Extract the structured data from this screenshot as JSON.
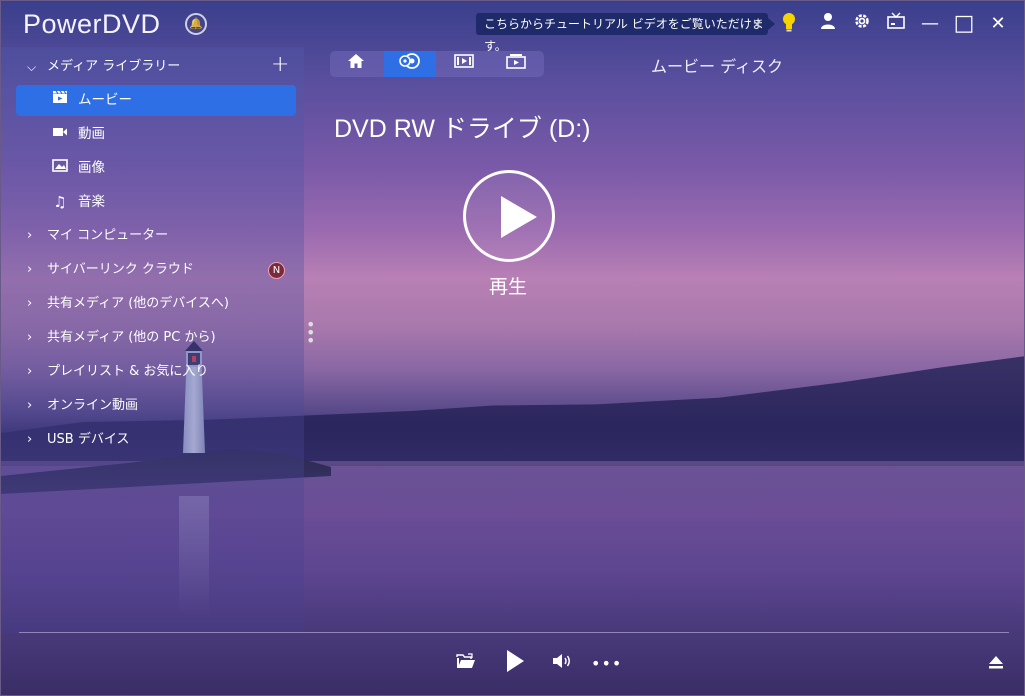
{
  "app": {
    "title": "PowerDVD"
  },
  "titlebar": {
    "tooltip": "こちらからチュートリアル ビデオをご覧いただけます。",
    "tooltip_close": "×",
    "icons": [
      "bell-icon",
      "lightbulb-icon",
      "user-icon",
      "gear-icon",
      "tv-mode-icon",
      "minimize-icon",
      "maximize-icon",
      "close-icon"
    ],
    "minimize": "—",
    "maximize": "□",
    "close": "✕"
  },
  "sidebar": {
    "library_label": "メディア ライブラリー",
    "library_items": [
      {
        "label": "ムービー",
        "icon": "movie-icon",
        "active": true
      },
      {
        "label": "動画",
        "icon": "video-icon",
        "active": false
      },
      {
        "label": "画像",
        "icon": "image-icon",
        "active": false
      },
      {
        "label": "音楽",
        "icon": "music-icon",
        "active": false
      }
    ],
    "nav_items": [
      {
        "label": "マイ コンピューター"
      },
      {
        "label": "サイバーリンク クラウド",
        "badge": "N"
      },
      {
        "label": "共有メディア (他のデバイスへ)"
      },
      {
        "label": "共有メディア (他の PC から)"
      },
      {
        "label": "プレイリスト & お気に入り"
      },
      {
        "label": "オンライン動画"
      },
      {
        "label": "USB デバイス"
      }
    ]
  },
  "view_tabs": [
    {
      "icon": "home-icon",
      "active": false
    },
    {
      "icon": "disc-icon",
      "active": true
    },
    {
      "icon": "movie-frame-icon",
      "active": false
    },
    {
      "icon": "tv-frame-icon",
      "active": false
    }
  ],
  "main": {
    "section_title": "ムービー ディスク",
    "drive_title": "DVD RW ドライブ (D:)",
    "play_label": "再生"
  },
  "colors": {
    "accent": "#2f6fe6",
    "tooltip_bg": "#1f2a6a",
    "bulb": "#f5d400"
  }
}
